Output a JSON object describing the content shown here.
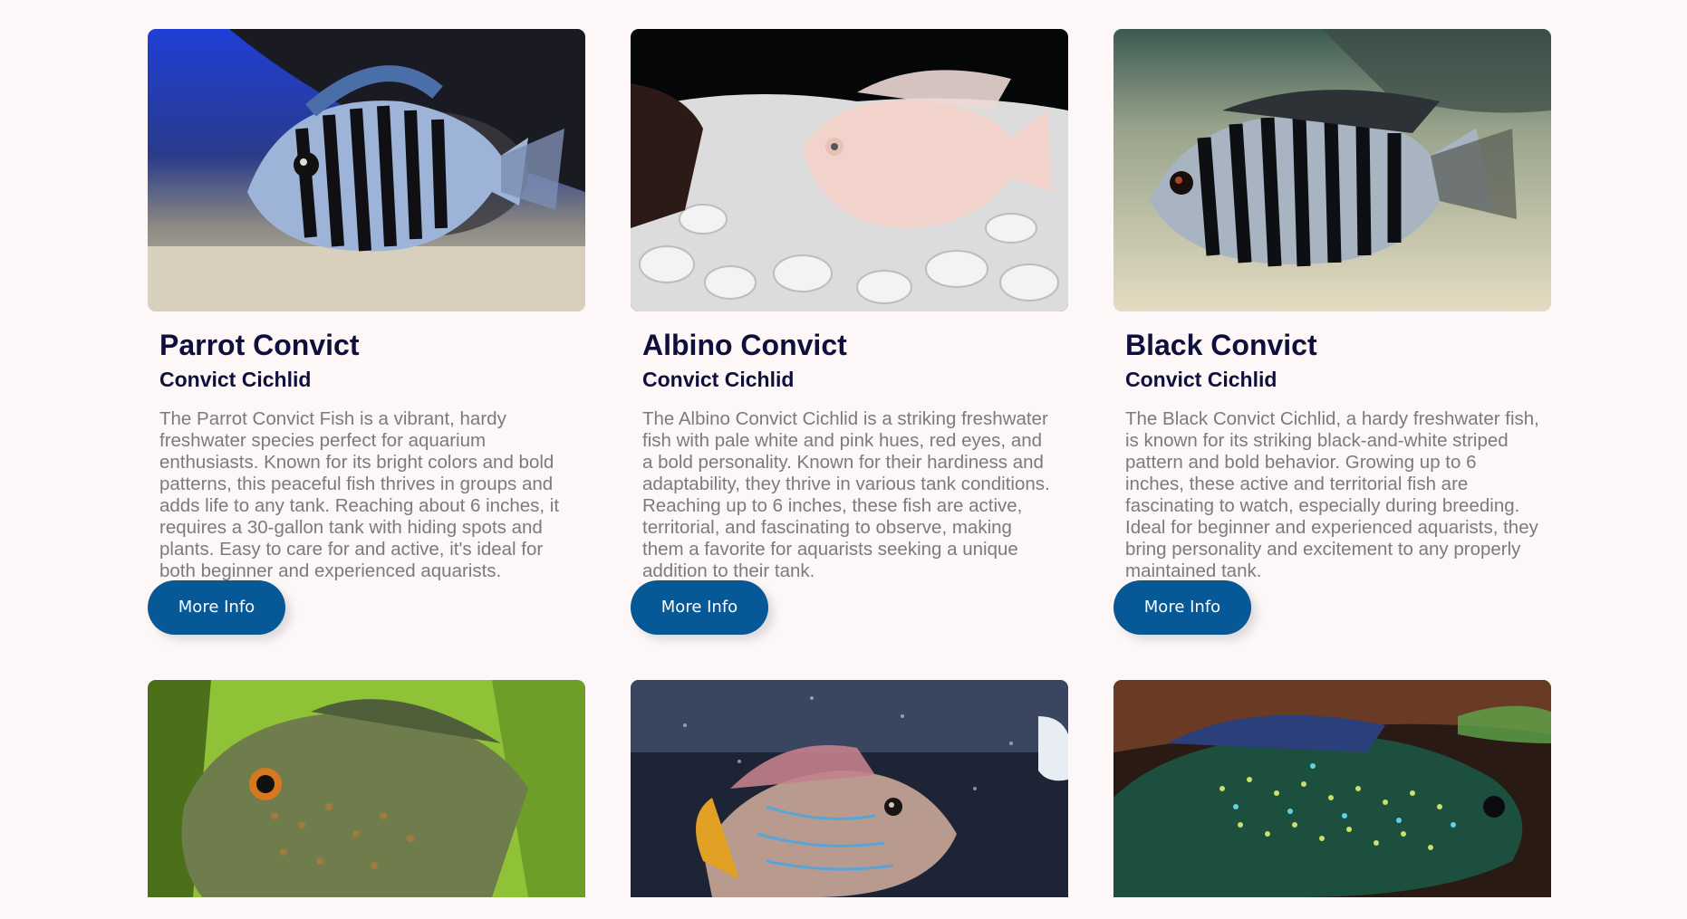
{
  "cards": [
    {
      "title": "Parrot Convict",
      "subtitle": "Convict Cichlid",
      "description": "The Parrot Convict Fish is a vibrant, hardy freshwater species perfect for aquarium enthusiasts. Known for its bright colors and bold patterns, this peaceful fish thrives in groups and adds life to any tank. Reaching about 6 inches, it requires a 30-gallon tank with hiding spots and plants. Easy to care for and active, it's ideal for both beginner and experienced aquarists.",
      "button": "More Info"
    },
    {
      "title": "Albino Convict",
      "subtitle": "Convict Cichlid",
      "description": "The Albino Convict Cichlid is a striking freshwater fish with pale white and pink hues, red eyes, and a bold personality. Known for their hardiness and adaptability, they thrive in various tank conditions. Reaching up to 6 inches, these fish are active, territorial, and fascinating to observe, making them a favorite for aquarists seeking a unique addition to their tank.",
      "button": "More Info"
    },
    {
      "title": "Black Convict",
      "subtitle": "Convict Cichlid",
      "description": "The Black Convict Cichlid, a hardy freshwater fish, is known for its striking black-and-white striped pattern and bold behavior. Growing up to 6 inches, these active and territorial fish are fascinating to watch, especially during breeding. Ideal for beginner and experienced aquarists, they bring personality and excitement to any properly maintained tank.",
      "button": "More Info"
    }
  ],
  "colors": {
    "background": "#fdf7f7",
    "title": "#0f0f3d",
    "text": "#7b7b7b",
    "button": "#075896"
  }
}
